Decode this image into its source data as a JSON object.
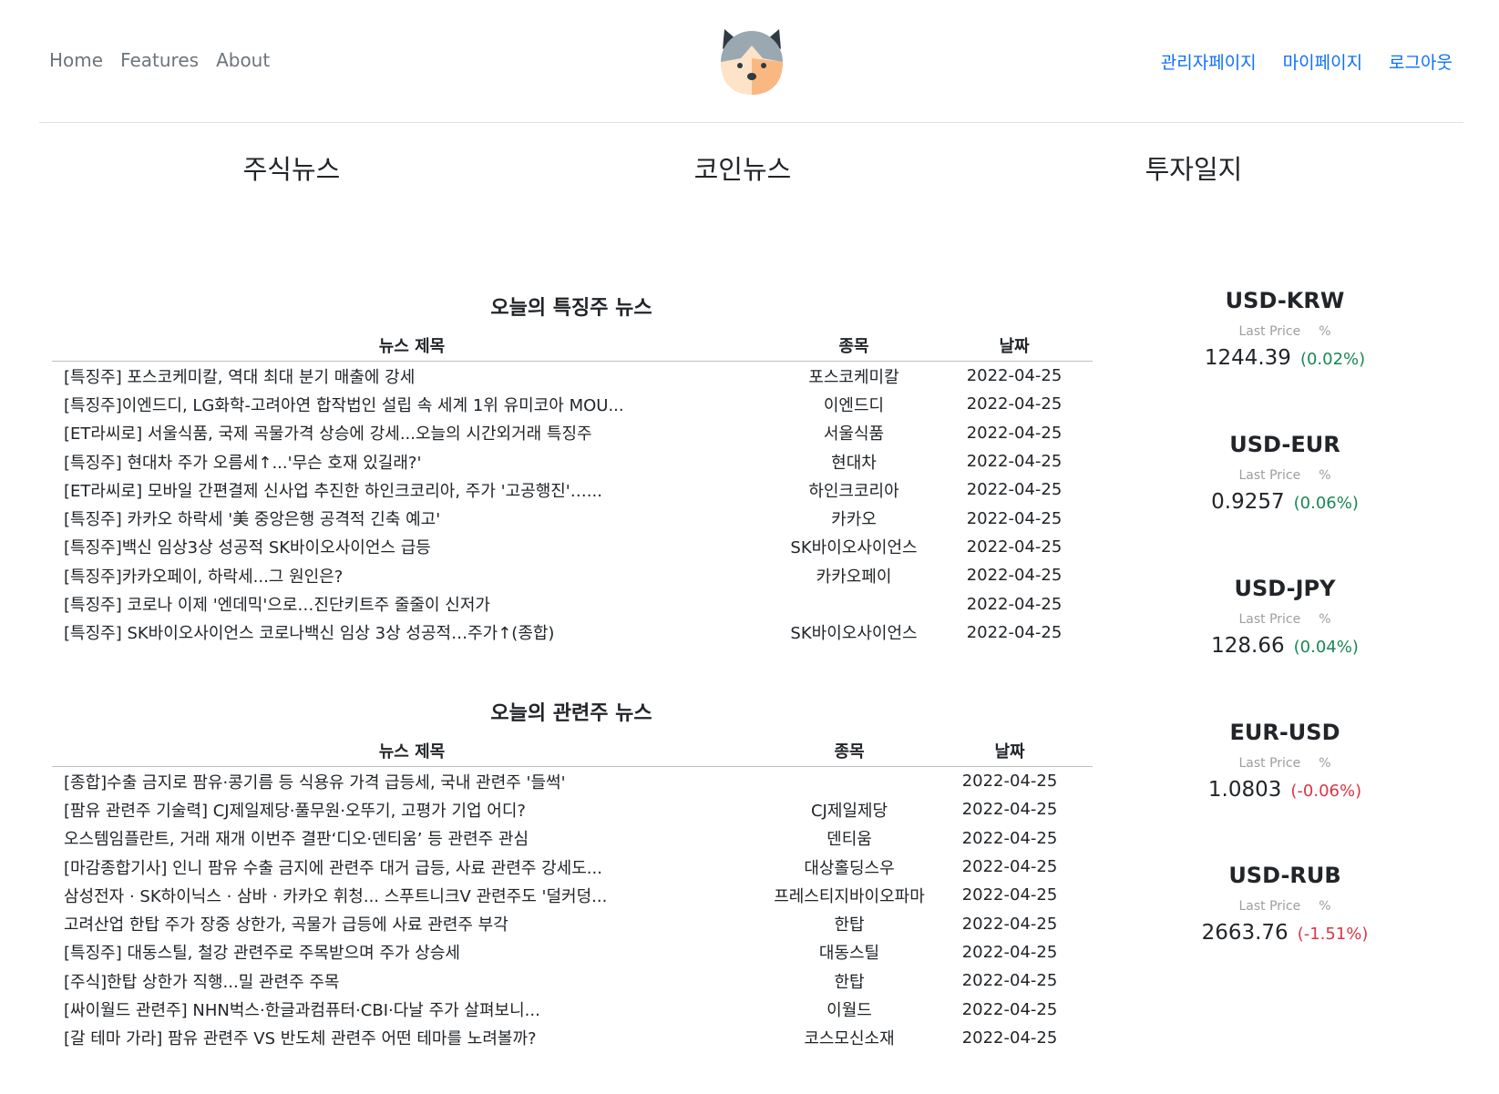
{
  "nav": {
    "left": [
      "Home",
      "Features",
      "About"
    ],
    "right": [
      "관리자페이지",
      "마이페이지",
      "로그아웃"
    ]
  },
  "tabs": [
    "주식뉴스",
    "코인뉴스",
    "투자일지"
  ],
  "featured": {
    "title": "오늘의 특징주 뉴스",
    "headers": [
      "뉴스 제목",
      "종목",
      "날짜"
    ],
    "rows": [
      [
        "[특징주] 포스코케미칼, 역대 최대 분기 매출에 강세",
        "포스코케미칼",
        "2022-04-25"
      ],
      [
        "[특징주]이엔드디, LG화학-고려아연 합작법인 설립 속 세계 1위 유미코아 MOU...",
        "이엔드디",
        "2022-04-25"
      ],
      [
        "[ET라씨로] 서울식품, 국제 곡물가격 상승에 강세...오늘의 시간외거래 특징주",
        "서울식품",
        "2022-04-25"
      ],
      [
        "[특징주] 현대차 주가 오름세↑...'무슨 호재 있길래?'",
        "현대차",
        "2022-04-25"
      ],
      [
        "[ET라씨로] 모바일 간편결제 신사업 추진한 하인크코리아, 주가 '고공행진'…...",
        "하인크코리아",
        "2022-04-25"
      ],
      [
        "[특징주] 카카오 하락세 '美 중앙은행 공격적 긴축 예고'",
        "카카오",
        "2022-04-25"
      ],
      [
        "[특징주]백신 임상3상 성공적 SK바이오사이언스 급등",
        "SK바이오사이언스",
        "2022-04-25"
      ],
      [
        "[특징주]카카오페이, 하락세...그 원인은?",
        "카카오페이",
        "2022-04-25"
      ],
      [
        "[특징주] 코로나 이제 '엔데믹'으로…진단키트주 줄줄이 신저가",
        "",
        "2022-04-25"
      ],
      [
        "[특징주] SK바이오사이언스 코로나백신 임상 3상 성공적…주가↑(종합)",
        "SK바이오사이언스",
        "2022-04-25"
      ]
    ]
  },
  "related": {
    "title": "오늘의 관련주 뉴스",
    "headers": [
      "뉴스 제목",
      "종목",
      "날짜"
    ],
    "rows": [
      [
        "[종합]수출 금지로 팜유·콩기름 등 식용유 가격 급등세, 국내 관련주 '들썩'",
        "",
        "2022-04-25"
      ],
      [
        "[팜유 관련주 기술력] CJ제일제당·풀무원·오뚜기, 고평가 기업 어디?",
        "CJ제일제당",
        "2022-04-25"
      ],
      [
        "오스템임플란트, 거래 재개 이번주 결판‘디오·덴티움’ 등 관련주 관심",
        "덴티움",
        "2022-04-25"
      ],
      [
        "[마감종합기사] 인니 팜유 수출 금지에 관련주 대거 급등, 사료 관련주 강세도...",
        "대상홀딩스우",
        "2022-04-25"
      ],
      [
        "삼성전자 · SK하이닉스 · 삼바 · 카카오 휘청... 스푸트니크V 관련주도 '덜커덩...",
        "프레스티지바이오파마",
        "2022-04-25"
      ],
      [
        "고려산업 한탑 주가 장중 상한가, 곡물가 급등에 사료 관련주 부각",
        "한탑",
        "2022-04-25"
      ],
      [
        "[특징주] 대동스틸, 철강 관련주로 주목받으며 주가 상승세",
        "대동스틸",
        "2022-04-25"
      ],
      [
        "[주식]한탑 상한가 직행...밀 관련주 주목",
        "한탑",
        "2022-04-25"
      ],
      [
        "[싸이월드 관련주] NHN벅스·한글과컴퓨터·CBI·다날 주가 살펴보니...",
        "이월드",
        "2022-04-25"
      ],
      [
        "[갈 테마 가라] 팜유 관련주 VS 반도체 관련주 어떤 테마를 노려볼까?",
        "코스모신소재",
        "2022-04-25"
      ]
    ]
  },
  "fx": [
    {
      "pair": "USD-KRW",
      "last_label": "Last Price",
      "pct_label": "%",
      "price": "1244.39",
      "change": "(0.02%)",
      "direction": "up"
    },
    {
      "pair": "USD-EUR",
      "last_label": "Last Price",
      "pct_label": "%",
      "price": "0.9257",
      "change": "(0.06%)",
      "direction": "up"
    },
    {
      "pair": "USD-JPY",
      "last_label": "Last Price",
      "pct_label": "%",
      "price": "128.66",
      "change": "(0.04%)",
      "direction": "up"
    },
    {
      "pair": "EUR-USD",
      "last_label": "Last Price",
      "pct_label": "%",
      "price": "1.0803",
      "change": "(-0.06%)",
      "direction": "down"
    },
    {
      "pair": "USD-RUB",
      "last_label": "Last Price",
      "pct_label": "%",
      "price": "2663.76",
      "change": "(-1.51%)",
      "direction": "down"
    }
  ],
  "colors": {
    "link": "#0d6efd",
    "muted": "#6c757d",
    "up": "#198754",
    "down": "#dc3545"
  }
}
